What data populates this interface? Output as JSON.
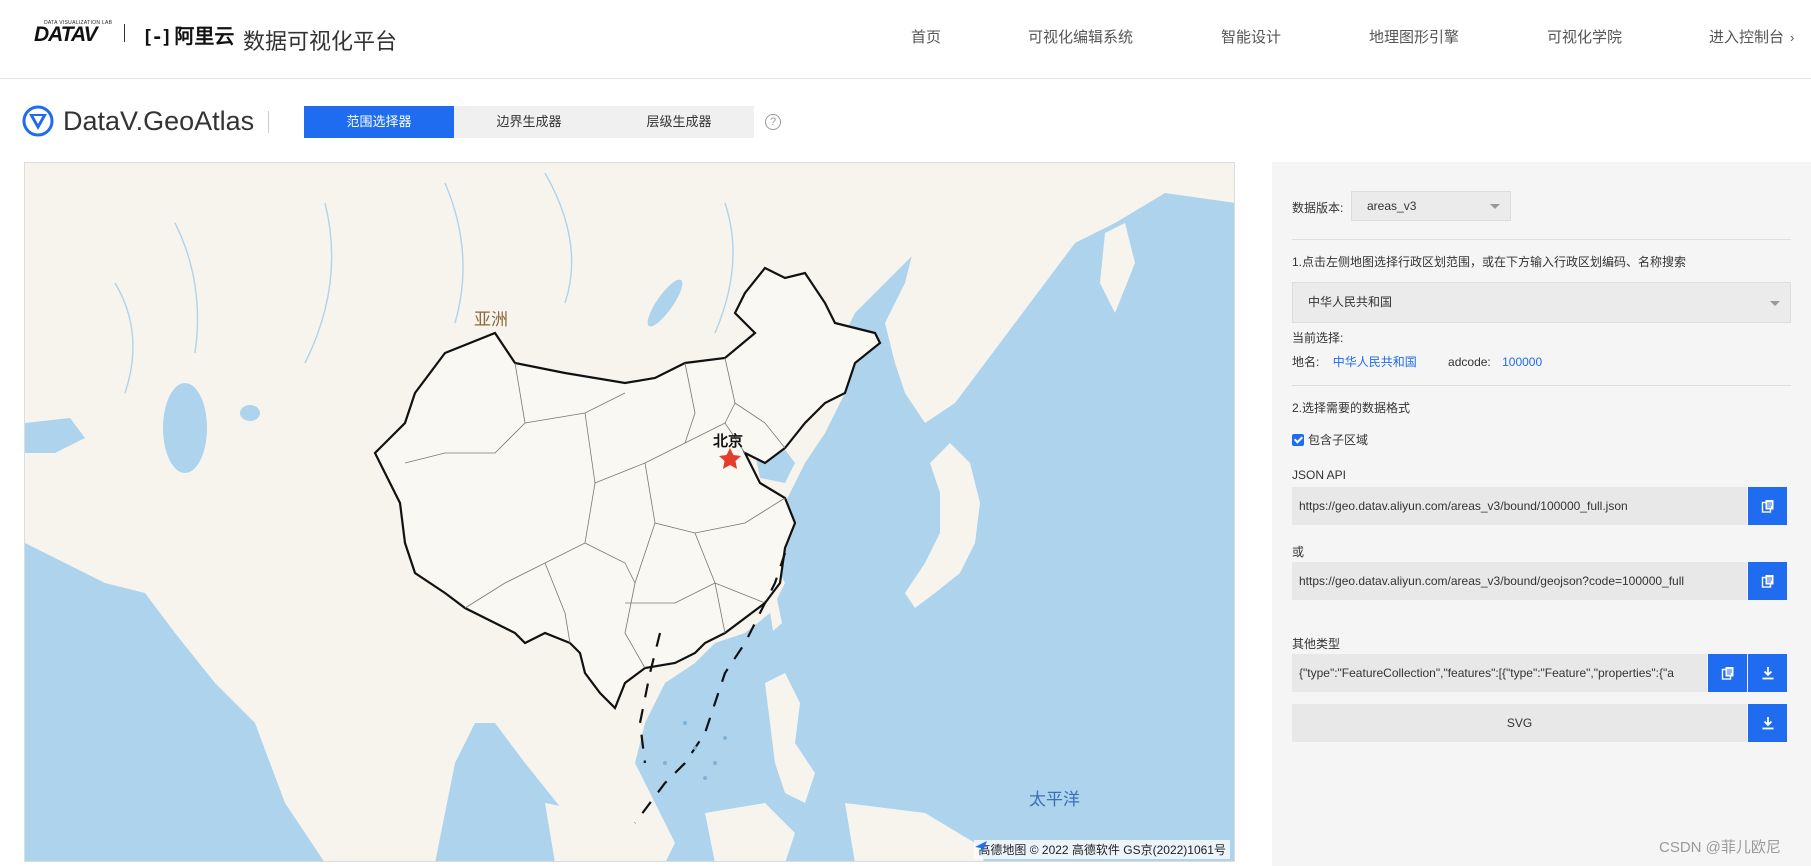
{
  "header": {
    "logo_datav_small": "DATA VISUALIZATION LAB",
    "logo_datav": "DATAV",
    "logo_aliyun_bracket": "[-]",
    "logo_aliyun": "阿里云",
    "platform_title": "数据可视化平台",
    "nav": [
      {
        "label": "首页"
      },
      {
        "label": "可视化编辑系统"
      },
      {
        "label": "智能设计"
      },
      {
        "label": "地理图形引擎"
      },
      {
        "label": "可视化学院"
      },
      {
        "label": "进入控制台"
      }
    ]
  },
  "app": {
    "name": "DataV.GeoAtlas",
    "tabs": [
      {
        "label": "范围选择器",
        "active": true
      },
      {
        "label": "边界生成器",
        "active": false
      },
      {
        "label": "层级生成器",
        "active": false
      }
    ],
    "help_glyph": "?"
  },
  "map": {
    "labels": {
      "asia": "亚洲",
      "beijing": "北京",
      "pacific": "太平洋"
    },
    "attribution": "高德地图 © 2022 高德软件 GS京(2022)1061号",
    "colors": {
      "water": "#aed3ec",
      "land": "#f7f4ee",
      "china_fill": "#faf8f3",
      "border": "#111111",
      "accent": "#e63c2c"
    }
  },
  "panel": {
    "version_label": "数据版本:",
    "version_value": "areas_v3",
    "step1": "1.点击左侧地图选择行政区划范围，或在下方输入行政区划编码、名称搜索",
    "region_select": "中华人民共和国",
    "current_label": "当前选择:",
    "name_label": "地名:",
    "name_value": "中华人民共和国",
    "adcode_label": "adcode:",
    "adcode_value": "100000",
    "step2": "2.选择需要的数据格式",
    "include_sub": "包含子区域",
    "include_sub_checked": true,
    "json_api_label": "JSON API",
    "json_api_url": "https://geo.datav.aliyun.com/areas_v3/bound/100000_full.json",
    "or_label": "或",
    "geojson_url": "https://geo.datav.aliyun.com/areas_v3/bound/geojson?code=100000_full",
    "other_label": "其他类型",
    "other_value": "{\"type\":\"FeatureCollection\",\"features\":[{\"type\":\"Feature\",\"properties\":{\"a",
    "svg_label": "SVG",
    "accent": "#1f6cf0"
  },
  "watermark": "CSDN @菲儿欧尼"
}
